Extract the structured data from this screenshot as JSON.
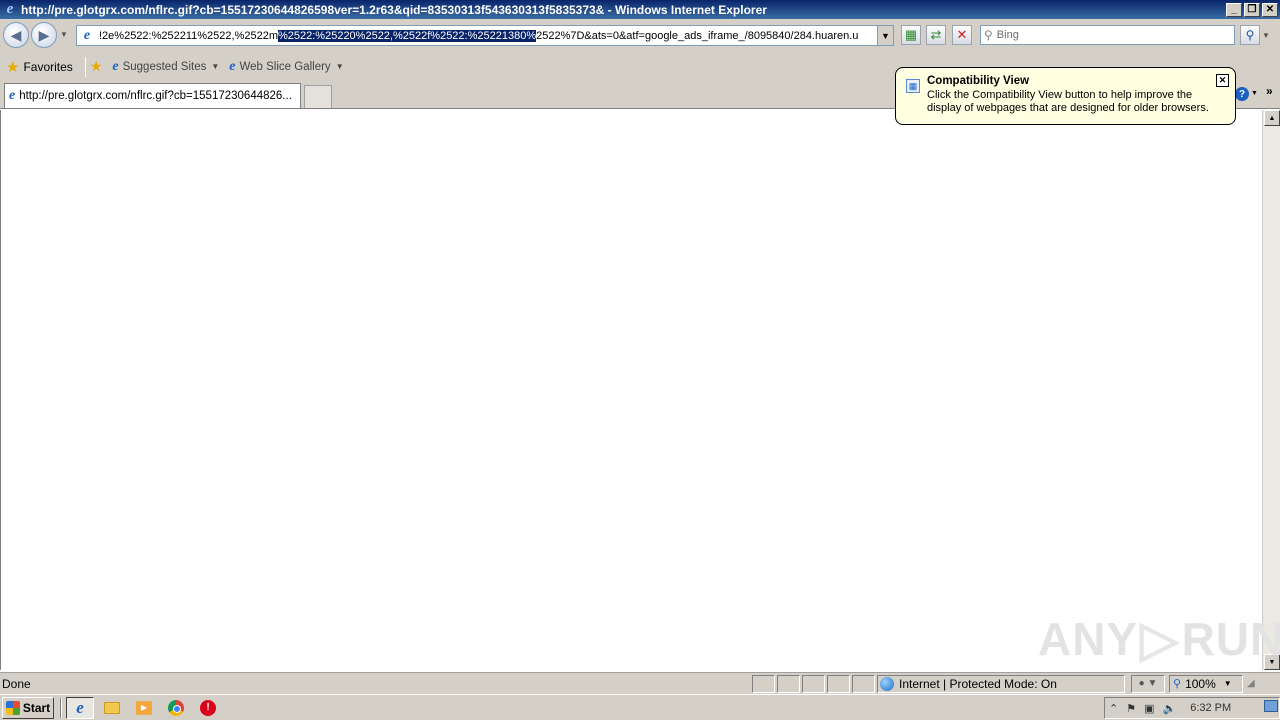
{
  "window": {
    "title": "http://pre.glotgrx.com/nflrc.gif?cb=15517230644826598ver=1.2r63&qid=83530313f543630313f5835373& - Windows Internet Explorer",
    "controls": {
      "minimize": "_",
      "restore": "❐",
      "close": "✕"
    }
  },
  "address": {
    "text_before": "!2e%2522:%252211%2522,%2522m",
    "text_selected": "%2522:%25220%2522,%2522f%2522:%25221380%",
    "text_after": "2522%7D&ats=0&atf=google_ads_iframe_/8095840/284.huaren.u"
  },
  "search": {
    "placeholder": "Bing"
  },
  "favorites": {
    "label": "Favorites",
    "links": [
      {
        "label": "Suggested Sites"
      },
      {
        "label": "Web Slice Gallery"
      }
    ]
  },
  "tab": {
    "label": "http://pre.glotgrx.com/nflrc.gif?cb=15517230644826..."
  },
  "balloon": {
    "title": "Compatibility View",
    "text": "Click the Compatibility View button to help improve the display of webpages that are designed for older browsers."
  },
  "watermark": {
    "left": "ANY",
    "right": "RUN"
  },
  "status": {
    "text": "Done",
    "zone": "Internet | Protected Mode: On",
    "zoom": "100%"
  },
  "taskbar": {
    "start": "Start",
    "clock": "6:32 PM"
  },
  "colors": {
    "titlebar": "#0a246a",
    "chrome": "#d4d0c8",
    "balloon": "#ffffe1",
    "selection": "#0a246a"
  }
}
